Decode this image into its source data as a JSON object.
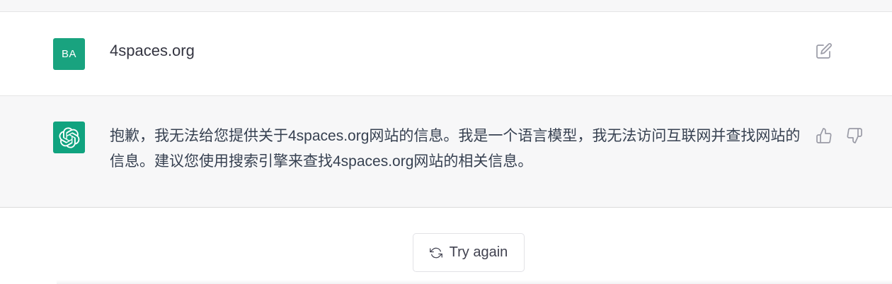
{
  "conversation": {
    "user_message": {
      "avatar_initials": "BA",
      "text": "4spaces.org",
      "edit_icon": "edit-icon"
    },
    "assistant_message": {
      "avatar_icon": "openai-logo-icon",
      "text": "抱歉，我无法给您提供关于4spaces.org网站的信息。我是一个语言模型，我无法访问互联网并查找网站的信息。建议您使用搜索引擎来查找4spaces.org网站的相关信息。",
      "feedback_icons": [
        "thumbs-up-icon",
        "thumbs-down-icon"
      ]
    }
  },
  "actions": {
    "try_again_label": "Try again",
    "try_again_icon": "refresh-icon"
  },
  "colors": {
    "avatar_green": "#19a37f",
    "assistant_row_bg": "#f7f7f8",
    "icon_gray": "#9a9ba6"
  }
}
